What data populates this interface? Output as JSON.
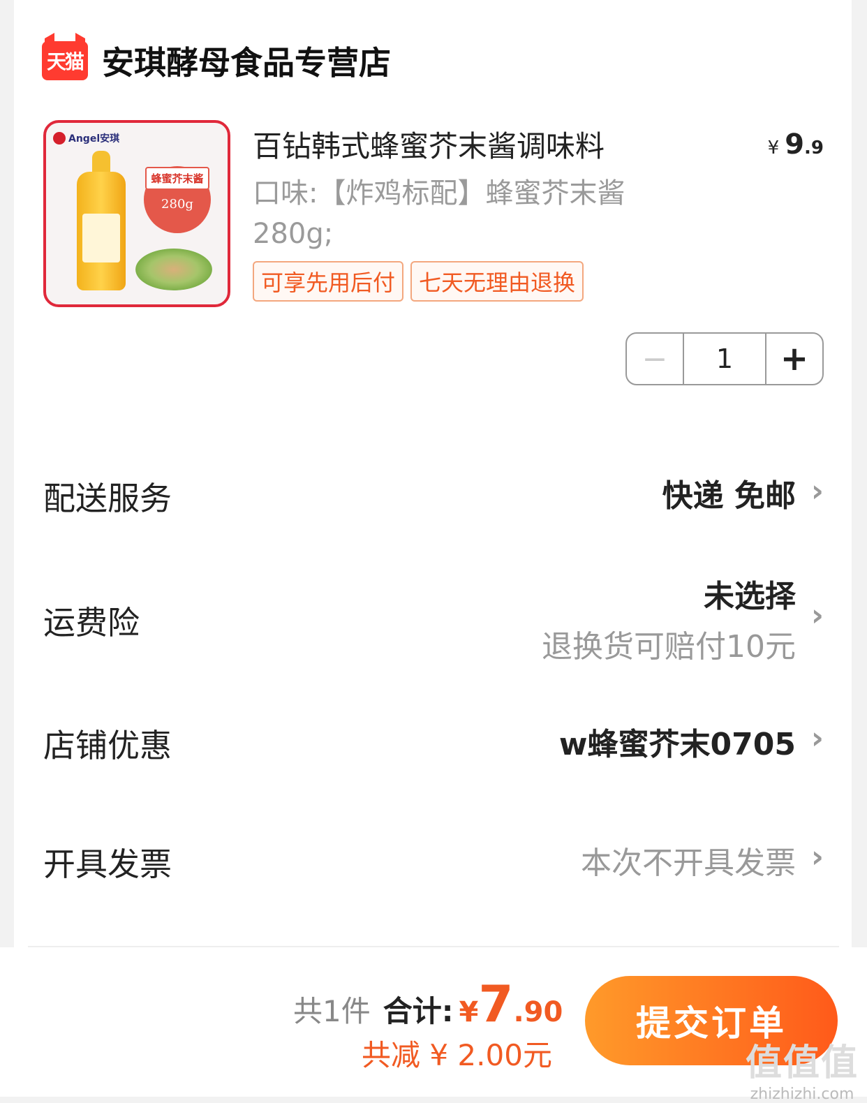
{
  "shop": {
    "logo_text": "天猫",
    "name": "安琪酵母食品专营店"
  },
  "product": {
    "image_brand": "Angel安琪",
    "image_badge": "蜂蜜芥末酱",
    "image_weight": "280g",
    "title": "百钻韩式蜂蜜芥末酱调味料",
    "price_currency": "¥",
    "price_int": "9",
    "price_dec": ".9",
    "spec": "口味:【炸鸡标配】蜂蜜芥末酱 280g;",
    "tags": [
      "可享先用后付",
      "七天无理由退换"
    ],
    "quantity": "1",
    "minus": "−",
    "plus": "+"
  },
  "rows": {
    "delivery": {
      "label": "配送服务",
      "value": "快递 免邮"
    },
    "insurance": {
      "label": "运费险",
      "value": "未选择",
      "sub": "退换货可赔付10元"
    },
    "coupon": {
      "label": "店铺优惠",
      "value": "w蜂蜜芥末0705"
    },
    "invoice": {
      "label": "开具发票",
      "value": "本次不开具发票"
    }
  },
  "chevron": "›",
  "footer": {
    "count": "共1件",
    "total_label": "合计:",
    "total_currency": "¥",
    "total_int": "7",
    "total_dec": ".90",
    "discount": "共减 ¥ 2.00元",
    "submit": "提交订单"
  },
  "watermark": {
    "big": "值值值",
    "small": "zhizhizhi.com"
  },
  "colors": {
    "accent": "#f15a22",
    "tmall_red": "#ff3b30"
  }
}
